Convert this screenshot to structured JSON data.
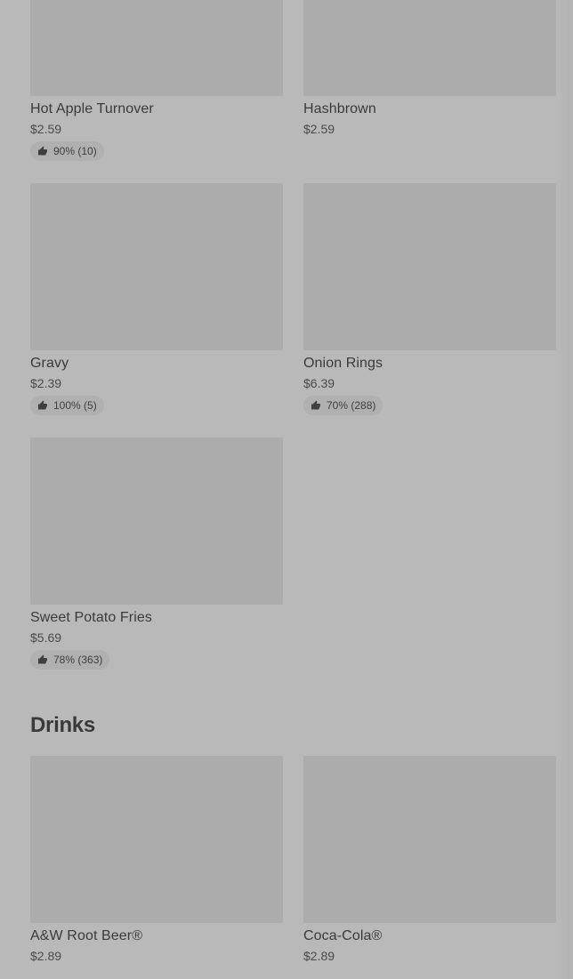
{
  "sides": {
    "items": [
      {
        "name": "Hot Apple Turnover",
        "price": "$2.59",
        "rating": "90% (10)"
      },
      {
        "name": "Hashbrown",
        "price": "$2.59",
        "rating": ""
      },
      {
        "name": "Gravy",
        "price": "$2.39",
        "rating": "100% (5)"
      },
      {
        "name": "Onion Rings",
        "price": "$6.39",
        "rating": "70% (288)"
      },
      {
        "name": "Sweet Potato Fries",
        "price": "$5.69",
        "rating": "78% (363)"
      }
    ]
  },
  "drinks": {
    "title": "Drinks",
    "items": [
      {
        "name": "A&W Root Beer®",
        "price": "$2.89"
      },
      {
        "name": "Coca-Cola®",
        "price": "$2.89"
      }
    ]
  },
  "icons": {
    "rating": "thumbs-up-icon"
  }
}
